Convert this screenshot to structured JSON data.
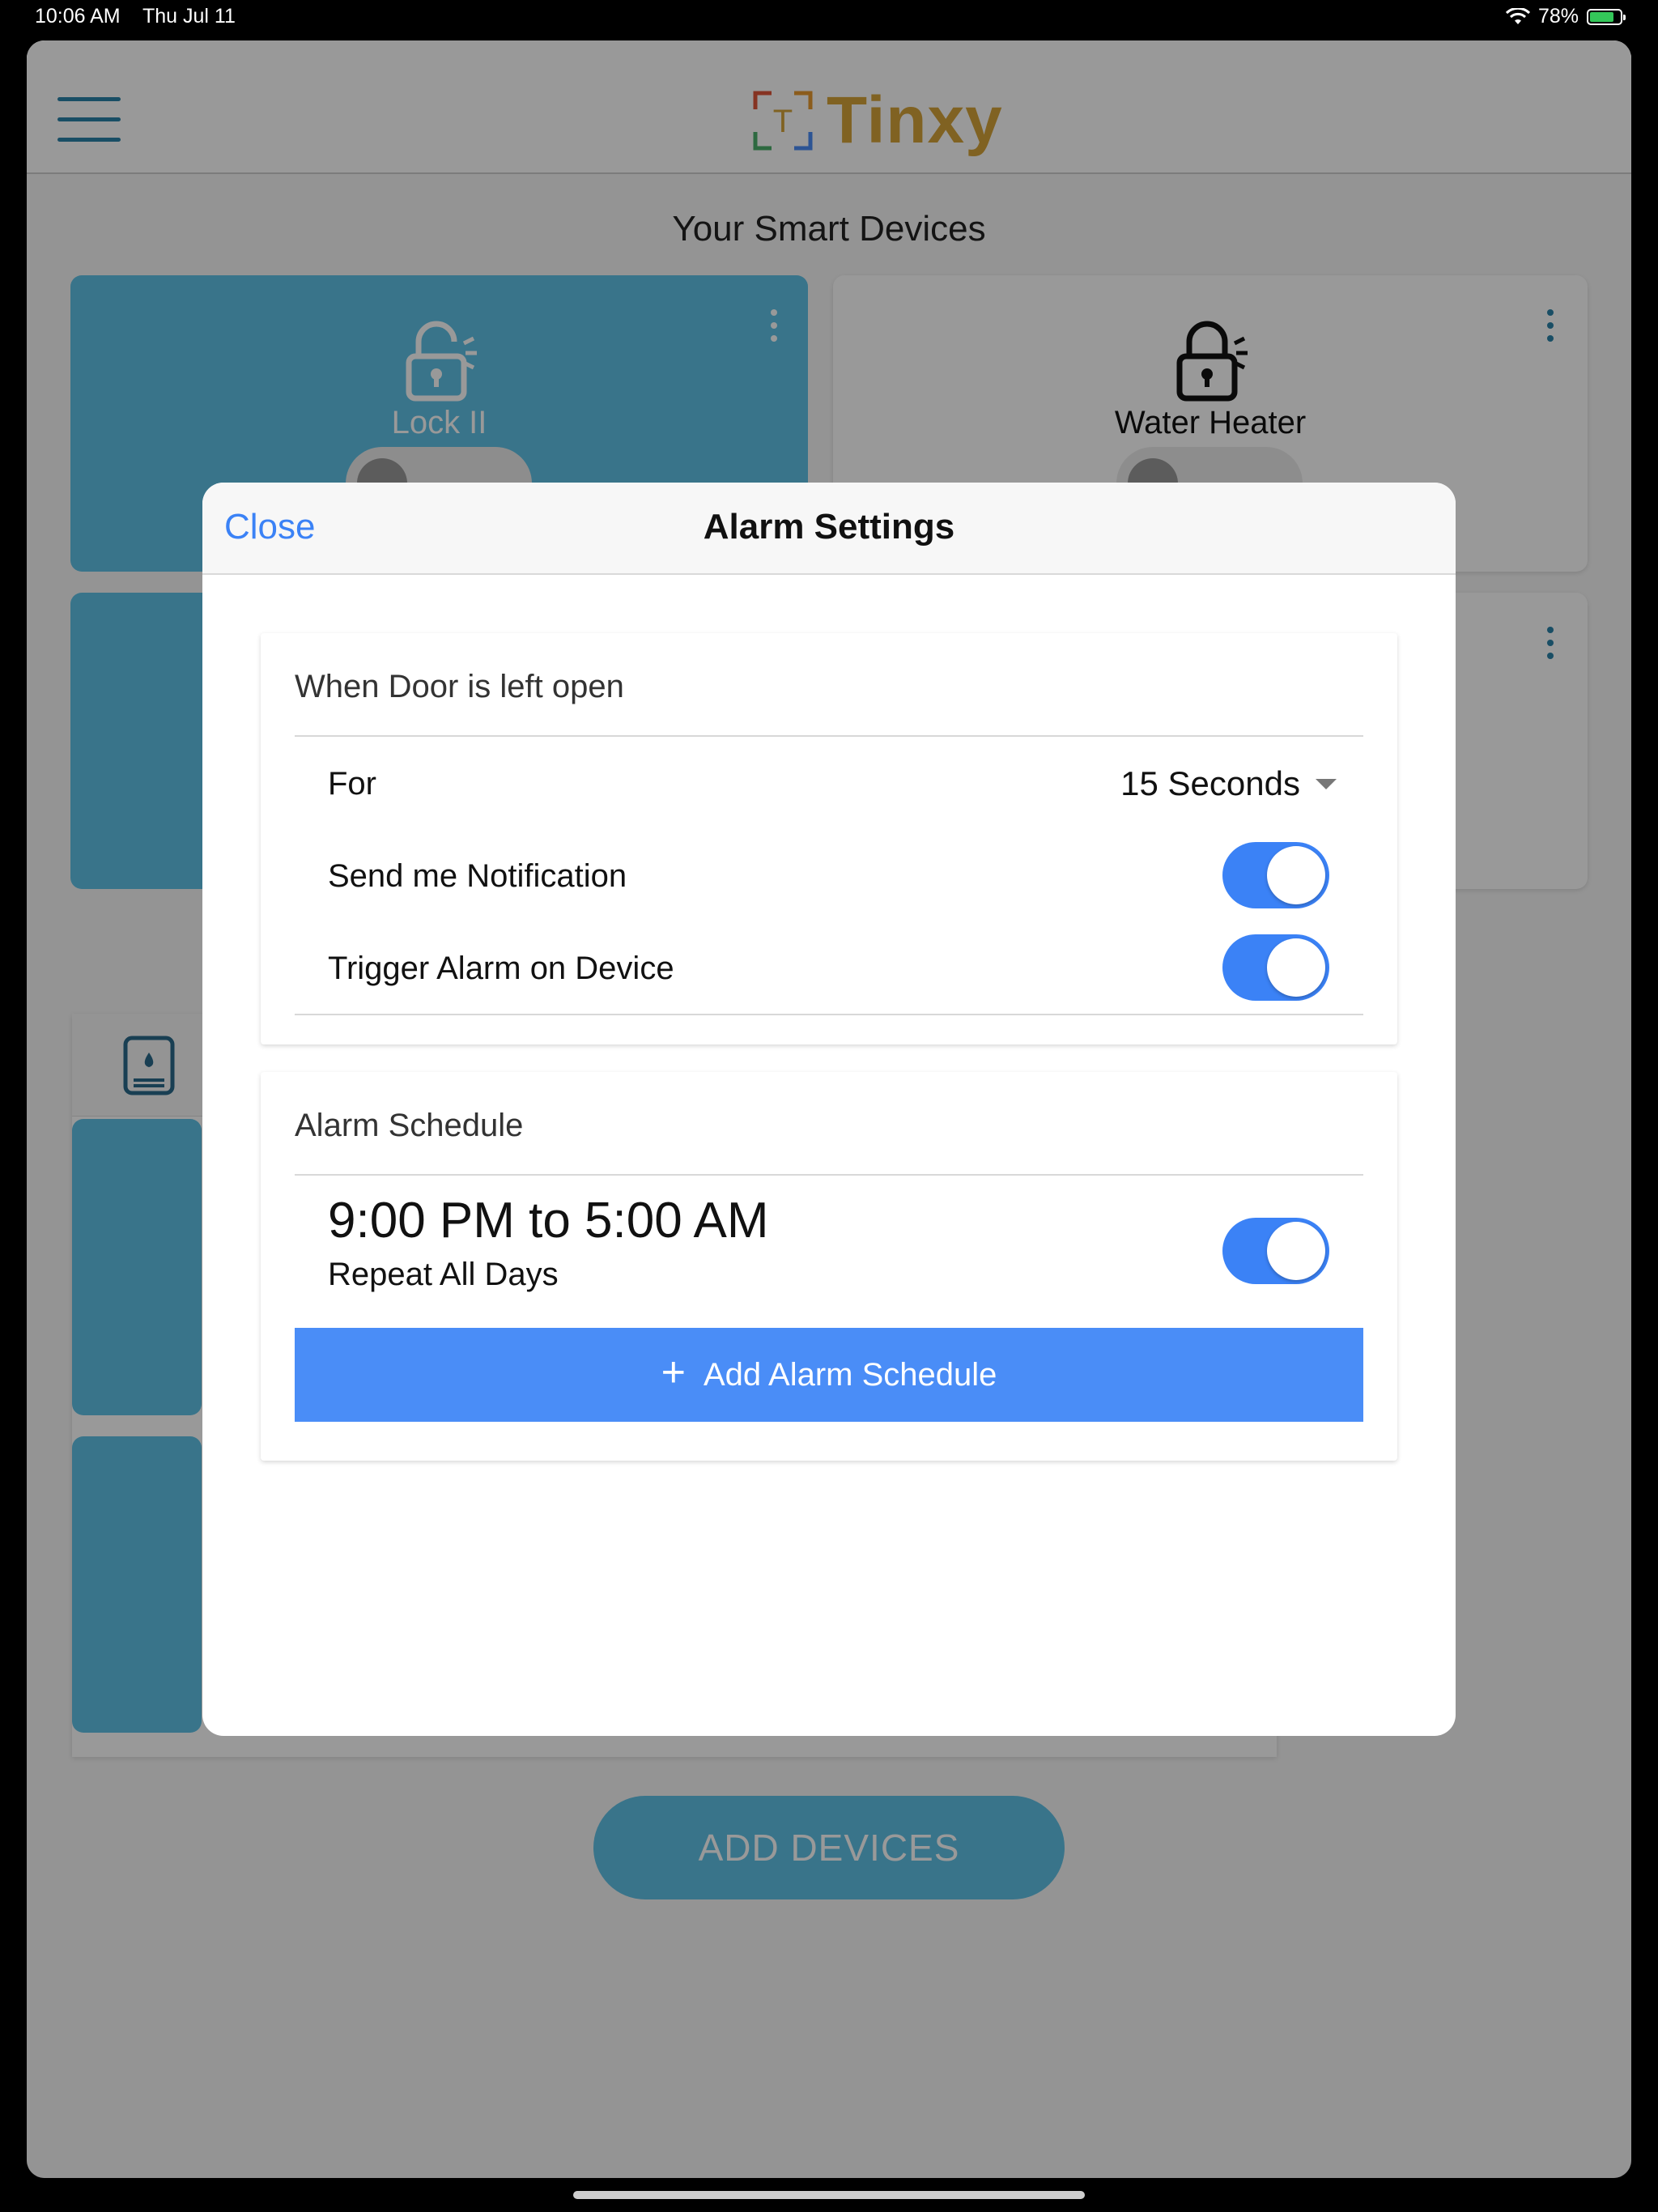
{
  "status_bar": {
    "time": "10:06 AM",
    "date": "Thu Jul 11",
    "battery": "78%",
    "battery_level": 0.78
  },
  "app": {
    "logo_letter": "T",
    "logo_text": "Tinxy",
    "page_title": "Your Smart Devices",
    "devices": [
      {
        "name": "Lock II",
        "style": "active"
      },
      {
        "name": "Water Heater",
        "style": "inactive"
      }
    ],
    "add_devices_label": "ADD DEVICES"
  },
  "modal": {
    "close_label": "Close",
    "title": "Alarm Settings",
    "door_section": {
      "title": "When Door is left open",
      "for_label": "For",
      "for_value": "15 Seconds",
      "notification_label": "Send me Notification",
      "notification_on": true,
      "trigger_label": "Trigger Alarm on Device",
      "trigger_on": true
    },
    "schedule_section": {
      "title": "Alarm Schedule",
      "items": [
        {
          "time": "9:00 PM to 5:00 AM",
          "repeat": "Repeat All Days",
          "enabled": true
        }
      ],
      "add_label": "Add Alarm Schedule",
      "add_icon": "plus-icon"
    }
  },
  "colors": {
    "accent": "#3b82f6",
    "teal": "#5fc1e6",
    "logo": "#d6a43a"
  }
}
